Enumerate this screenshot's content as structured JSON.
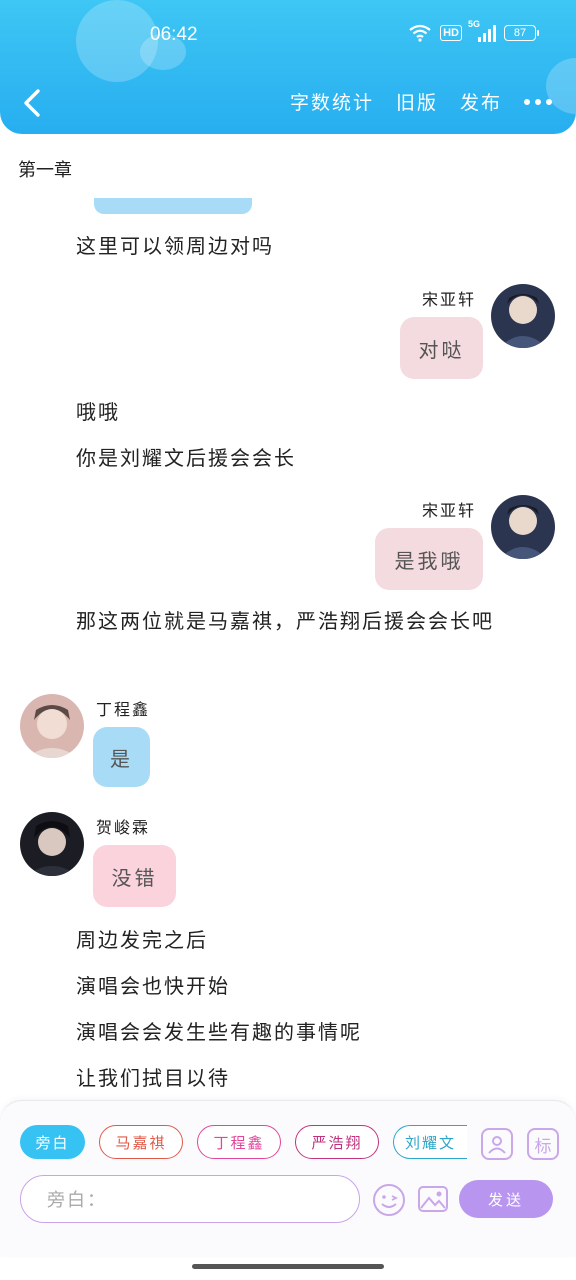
{
  "status": {
    "time": "06:42",
    "hd": "HD",
    "network": "5G",
    "battery": "87"
  },
  "nav": {
    "stats": "字数统计",
    "old_version": "旧版",
    "publish": "发布"
  },
  "chapter": "第一章",
  "lines": {
    "l1": "这里可以领周边对吗",
    "l2": "哦哦",
    "l3": "你是刘耀文后援会会长",
    "l4": "那这两位就是马嘉祺，严浩翔后援会会长吧",
    "l5": "周边发完之后",
    "l6": "演唱会也快开始",
    "l7": "演唱会会发生些有趣的事情呢",
    "l8": "让我们拭目以待"
  },
  "messages": [
    {
      "speaker": "宋亚轩",
      "text": "对哒"
    },
    {
      "speaker": "宋亚轩",
      "text": "是我哦"
    },
    {
      "speaker": "丁程鑫",
      "text": "是"
    },
    {
      "speaker": "贺峻霖",
      "text": "没错"
    }
  ],
  "chips": [
    "旁白",
    "马嘉祺",
    "丁程鑫",
    "严浩翔",
    "刘耀文"
  ],
  "chip_colors": [
    "#36c3f3",
    "#e05a4a",
    "#e0469c",
    "#c2337e",
    "#2ea6c9"
  ],
  "input": {
    "placeholder": "旁白："
  },
  "send_label": "发送",
  "tag_label": "标",
  "colors": {
    "header": "#2cb5f1",
    "bubble_pink": "#f4dbdf",
    "bubble_blue": "#a8dcf6",
    "bubble_rose": "#fbd3dd",
    "send": "#b896f0"
  }
}
